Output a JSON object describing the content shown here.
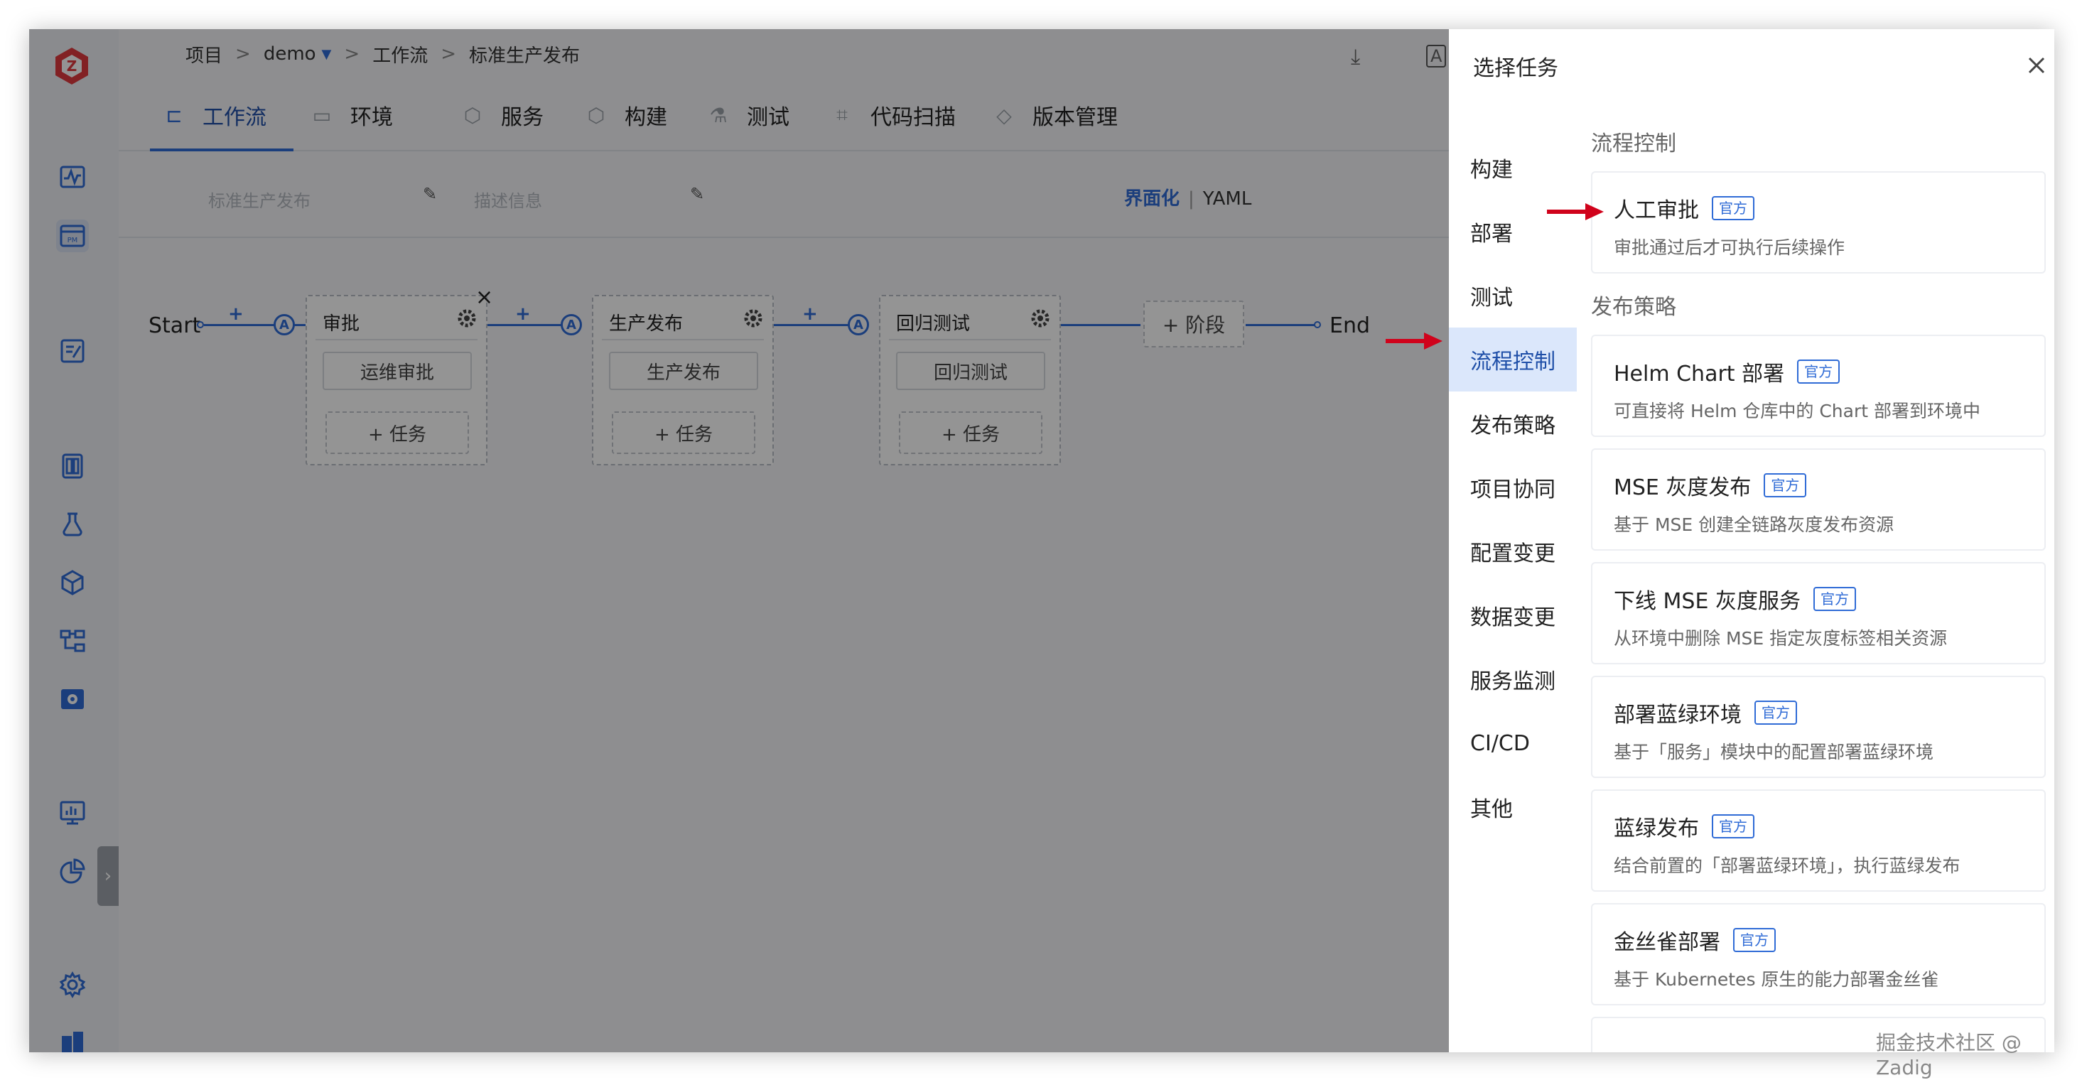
{
  "breadcrumb": {
    "items": [
      "项目",
      "demo",
      "工作流",
      "标准生产发布"
    ],
    "separator": ">"
  },
  "tabs": [
    {
      "label": "工作流",
      "icon": "workflow-icon"
    },
    {
      "label": "环境",
      "icon": "environment-icon"
    },
    {
      "label": "服务",
      "icon": "service-icon"
    },
    {
      "label": "构建",
      "icon": "build-icon"
    },
    {
      "label": "测试",
      "icon": "test-icon"
    },
    {
      "label": "代码扫描",
      "icon": "scan-icon"
    },
    {
      "label": "版本管理",
      "icon": "version-icon"
    }
  ],
  "workflow": {
    "name_placeholder": "标准生产发布",
    "desc_placeholder": "描述信息",
    "view_on": "界面化",
    "view_off": "YAML",
    "start": "Start",
    "end": "End",
    "add_stage": "+ 阶段",
    "plus": "+",
    "badge": "A",
    "add_task": "+ 任务",
    "stages": [
      {
        "title": "审批",
        "job": "运维审批"
      },
      {
        "title": "生产发布",
        "job": "生产发布"
      },
      {
        "title": "回归测试",
        "job": "回归测试"
      }
    ]
  },
  "drawer": {
    "title": "选择任务",
    "categories": [
      "构建",
      "部署",
      "测试",
      "流程控制",
      "发布策略",
      "项目协同",
      "配置变更",
      "数据变更",
      "服务监测",
      "CI/CD",
      "其他"
    ],
    "active_category": "流程控制",
    "official_label": "官方",
    "sections": [
      {
        "title": "流程控制",
        "items": [
          {
            "name": "人工审批",
            "desc": "审批通过后才可执行后续操作"
          }
        ]
      },
      {
        "title": "发布策略",
        "items": [
          {
            "name": "Helm Chart 部署",
            "desc": "可直接将 Helm 仓库中的 Chart 部署到环境中"
          },
          {
            "name": "MSE 灰度发布",
            "desc": "基于 MSE 创建全链路灰度发布资源"
          },
          {
            "name": "下线 MSE 灰度服务",
            "desc": "从环境中删除 MSE 指定灰度标签相关资源"
          },
          {
            "name": "部署蓝绿环境",
            "desc": "基于「服务」模块中的配置部署蓝绿环境"
          },
          {
            "name": "蓝绿发布",
            "desc": "结合前置的「部署蓝绿环境」，执行蓝绿发布"
          },
          {
            "name": "金丝雀部署",
            "desc": "基于 Kubernetes 原生的能力部署金丝雀"
          }
        ]
      }
    ]
  },
  "watermark": "掘金技术社区 @ Zadig",
  "colors": {
    "accent": "#2f6bd6",
    "annotation_arrow": "#d0021b",
    "overlay": "rgba(0,0,0,0.42)"
  }
}
